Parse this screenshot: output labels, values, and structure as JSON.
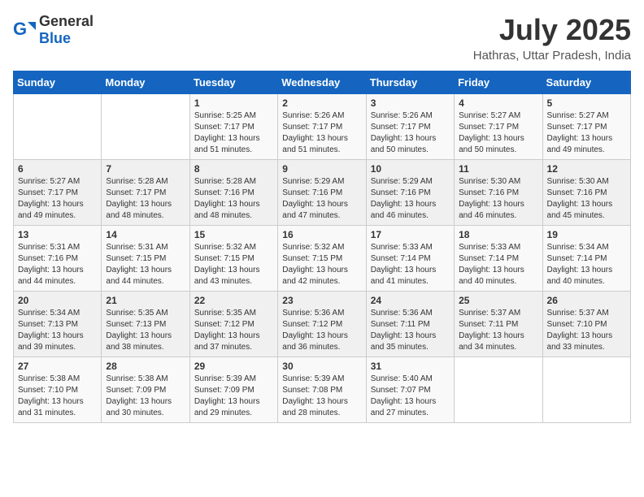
{
  "header": {
    "logo_general": "General",
    "logo_blue": "Blue",
    "month_title": "July 2025",
    "location": "Hathras, Uttar Pradesh, India"
  },
  "days_of_week": [
    "Sunday",
    "Monday",
    "Tuesday",
    "Wednesday",
    "Thursday",
    "Friday",
    "Saturday"
  ],
  "weeks": [
    [
      {
        "day": "",
        "info": ""
      },
      {
        "day": "",
        "info": ""
      },
      {
        "day": "1",
        "info": "Sunrise: 5:25 AM\nSunset: 7:17 PM\nDaylight: 13 hours and 51 minutes."
      },
      {
        "day": "2",
        "info": "Sunrise: 5:26 AM\nSunset: 7:17 PM\nDaylight: 13 hours and 51 minutes."
      },
      {
        "day": "3",
        "info": "Sunrise: 5:26 AM\nSunset: 7:17 PM\nDaylight: 13 hours and 50 minutes."
      },
      {
        "day": "4",
        "info": "Sunrise: 5:27 AM\nSunset: 7:17 PM\nDaylight: 13 hours and 50 minutes."
      },
      {
        "day": "5",
        "info": "Sunrise: 5:27 AM\nSunset: 7:17 PM\nDaylight: 13 hours and 49 minutes."
      }
    ],
    [
      {
        "day": "6",
        "info": "Sunrise: 5:27 AM\nSunset: 7:17 PM\nDaylight: 13 hours and 49 minutes."
      },
      {
        "day": "7",
        "info": "Sunrise: 5:28 AM\nSunset: 7:17 PM\nDaylight: 13 hours and 48 minutes."
      },
      {
        "day": "8",
        "info": "Sunrise: 5:28 AM\nSunset: 7:16 PM\nDaylight: 13 hours and 48 minutes."
      },
      {
        "day": "9",
        "info": "Sunrise: 5:29 AM\nSunset: 7:16 PM\nDaylight: 13 hours and 47 minutes."
      },
      {
        "day": "10",
        "info": "Sunrise: 5:29 AM\nSunset: 7:16 PM\nDaylight: 13 hours and 46 minutes."
      },
      {
        "day": "11",
        "info": "Sunrise: 5:30 AM\nSunset: 7:16 PM\nDaylight: 13 hours and 46 minutes."
      },
      {
        "day": "12",
        "info": "Sunrise: 5:30 AM\nSunset: 7:16 PM\nDaylight: 13 hours and 45 minutes."
      }
    ],
    [
      {
        "day": "13",
        "info": "Sunrise: 5:31 AM\nSunset: 7:16 PM\nDaylight: 13 hours and 44 minutes."
      },
      {
        "day": "14",
        "info": "Sunrise: 5:31 AM\nSunset: 7:15 PM\nDaylight: 13 hours and 44 minutes."
      },
      {
        "day": "15",
        "info": "Sunrise: 5:32 AM\nSunset: 7:15 PM\nDaylight: 13 hours and 43 minutes."
      },
      {
        "day": "16",
        "info": "Sunrise: 5:32 AM\nSunset: 7:15 PM\nDaylight: 13 hours and 42 minutes."
      },
      {
        "day": "17",
        "info": "Sunrise: 5:33 AM\nSunset: 7:14 PM\nDaylight: 13 hours and 41 minutes."
      },
      {
        "day": "18",
        "info": "Sunrise: 5:33 AM\nSunset: 7:14 PM\nDaylight: 13 hours and 40 minutes."
      },
      {
        "day": "19",
        "info": "Sunrise: 5:34 AM\nSunset: 7:14 PM\nDaylight: 13 hours and 40 minutes."
      }
    ],
    [
      {
        "day": "20",
        "info": "Sunrise: 5:34 AM\nSunset: 7:13 PM\nDaylight: 13 hours and 39 minutes."
      },
      {
        "day": "21",
        "info": "Sunrise: 5:35 AM\nSunset: 7:13 PM\nDaylight: 13 hours and 38 minutes."
      },
      {
        "day": "22",
        "info": "Sunrise: 5:35 AM\nSunset: 7:12 PM\nDaylight: 13 hours and 37 minutes."
      },
      {
        "day": "23",
        "info": "Sunrise: 5:36 AM\nSunset: 7:12 PM\nDaylight: 13 hours and 36 minutes."
      },
      {
        "day": "24",
        "info": "Sunrise: 5:36 AM\nSunset: 7:11 PM\nDaylight: 13 hours and 35 minutes."
      },
      {
        "day": "25",
        "info": "Sunrise: 5:37 AM\nSunset: 7:11 PM\nDaylight: 13 hours and 34 minutes."
      },
      {
        "day": "26",
        "info": "Sunrise: 5:37 AM\nSunset: 7:10 PM\nDaylight: 13 hours and 33 minutes."
      }
    ],
    [
      {
        "day": "27",
        "info": "Sunrise: 5:38 AM\nSunset: 7:10 PM\nDaylight: 13 hours and 31 minutes."
      },
      {
        "day": "28",
        "info": "Sunrise: 5:38 AM\nSunset: 7:09 PM\nDaylight: 13 hours and 30 minutes."
      },
      {
        "day": "29",
        "info": "Sunrise: 5:39 AM\nSunset: 7:09 PM\nDaylight: 13 hours and 29 minutes."
      },
      {
        "day": "30",
        "info": "Sunrise: 5:39 AM\nSunset: 7:08 PM\nDaylight: 13 hours and 28 minutes."
      },
      {
        "day": "31",
        "info": "Sunrise: 5:40 AM\nSunset: 7:07 PM\nDaylight: 13 hours and 27 minutes."
      },
      {
        "day": "",
        "info": ""
      },
      {
        "day": "",
        "info": ""
      }
    ]
  ]
}
